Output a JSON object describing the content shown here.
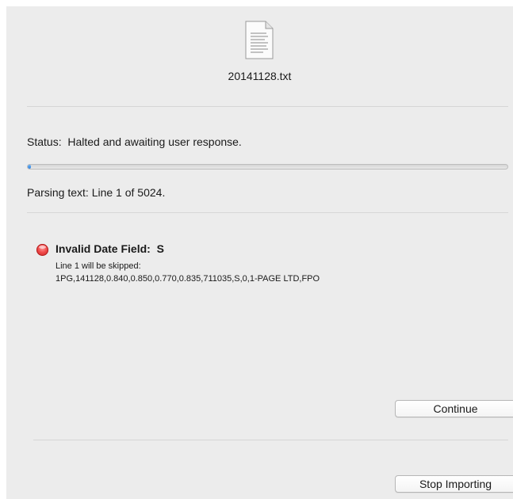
{
  "file": {
    "icon": "text-document-icon",
    "name": "20141128.txt"
  },
  "status": {
    "text": "Status:  Halted and awaiting user response."
  },
  "progress": {
    "current_line": 1,
    "total_lines": 5024,
    "fraction": 0.0002,
    "text": "Parsing text: Line 1 of 5024."
  },
  "error": {
    "icon": "red-error-dot-icon",
    "title": "Invalid Date Field:  S",
    "message": "Line 1 will be skipped:",
    "record": "1PG,141128,0.840,0.850,0.770,0.835,711035,S,0,1-PAGE LTD,FPO"
  },
  "buttons": {
    "continue_label": "Continue",
    "stop_label": "Stop Importing"
  },
  "colors": {
    "panel_background": "#ececec",
    "progress_accent": "#2c7fe0",
    "error_red": "#f04a4a"
  }
}
